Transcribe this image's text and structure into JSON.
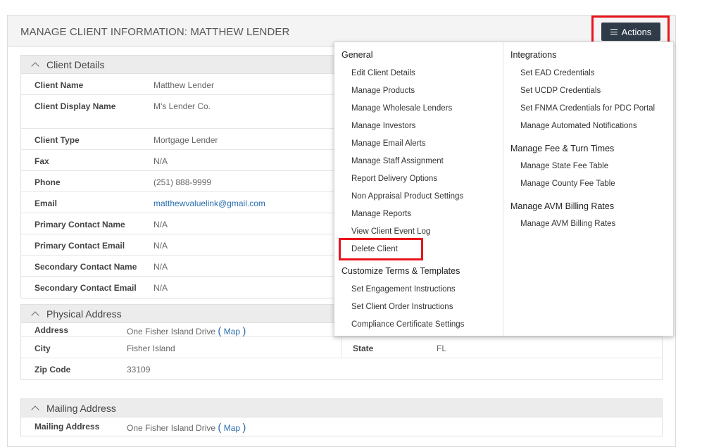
{
  "page": {
    "title": "MANAGE CLIENT INFORMATION: MATTHEW LENDER"
  },
  "actions": {
    "label": "Actions"
  },
  "client_details": {
    "header": "Client Details",
    "rows": [
      {
        "label": "Client Name",
        "value": "Matthew Lender"
      },
      {
        "label": "Client Display Name",
        "value": "M's Lender Co."
      },
      {
        "label": "Client Type",
        "value": "Mortgage Lender"
      },
      {
        "label": "Fax",
        "value": "N/A"
      },
      {
        "label": "Phone",
        "value": "(251) 888-9999"
      },
      {
        "label": "Email",
        "value": "matthewvaluelink@gmail.com"
      },
      {
        "label": "Primary Contact Name",
        "value": "N/A"
      },
      {
        "label": "Primary Contact Email",
        "value": "N/A"
      },
      {
        "label": "Secondary Contact Name",
        "value": "N/A"
      },
      {
        "label": "Secondary Contact Email",
        "value": "N/A"
      }
    ]
  },
  "physical_address": {
    "header": "Physical Address",
    "address_label": "Address",
    "address_value": "One Fisher Island Drive",
    "map_label": "Map",
    "city_label": "City",
    "city_value": "Fisher Island",
    "state_label": "State",
    "state_value": "FL",
    "zip_label": "Zip Code",
    "zip_value": "33109"
  },
  "mailing_address": {
    "header": "Mailing Address",
    "address_label": "Mailing Address",
    "address_value": "One Fisher Island Drive",
    "map_label": "Map"
  },
  "menu": {
    "general": {
      "header": "General",
      "items": [
        "Edit Client Details",
        "Manage Products",
        "Manage Wholesale Lenders",
        "Manage Investors",
        "Manage Email Alerts",
        "Manage Staff Assignment",
        "Report Delivery Options",
        "Non Appraisal Product Settings",
        "Manage Reports",
        "View Client Event Log",
        "Delete Client"
      ]
    },
    "customize": {
      "header": "Customize Terms & Templates",
      "items": [
        "Set Engagement Instructions",
        "Set Client Order Instructions",
        "Compliance Certificate Settings"
      ]
    },
    "integrations": {
      "header": "Integrations",
      "items": [
        "Set EAD Credentials",
        "Set UCDP Credentials",
        "Set FNMA Credentials for PDC Portal",
        "Manage Automated Notifications"
      ]
    },
    "fees": {
      "header": "Manage Fee & Turn Times",
      "items": [
        "Manage State Fee Table",
        "Manage County Fee Table"
      ]
    },
    "avm": {
      "header": "Manage AVM Billing Rates",
      "items": [
        "Manage AVM Billing Rates"
      ]
    }
  },
  "colors": {
    "highlight": "#e8141c",
    "actions_bg": "#2f3b49",
    "link": "#2a6fb0"
  }
}
